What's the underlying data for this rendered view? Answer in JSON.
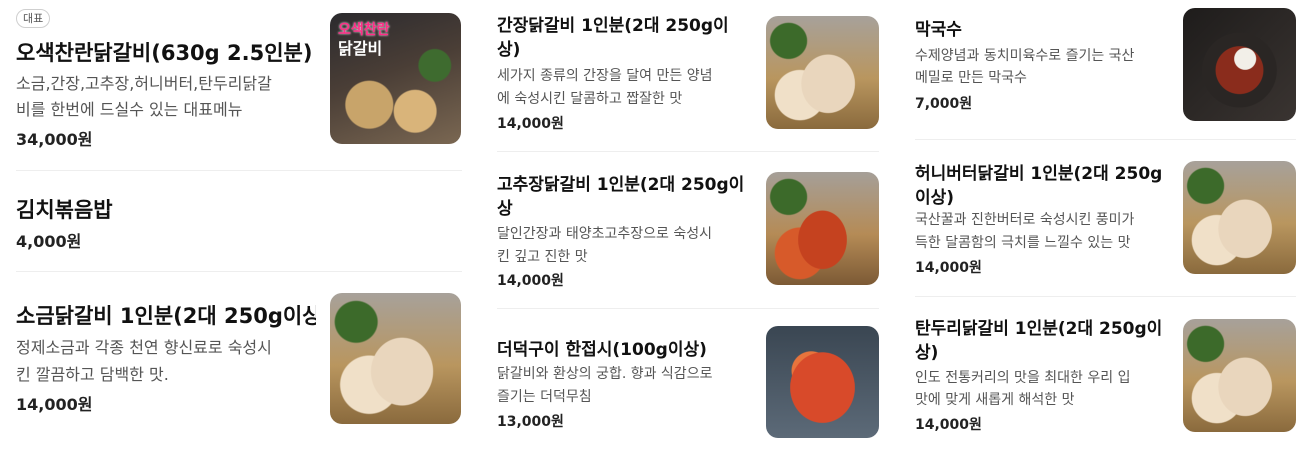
{
  "badge": "대표",
  "columns": [
    {
      "items": [
        {
          "name": "오색찬란닭갈비(630g 2.5인분)",
          "desc_lines": [
            "소금,간장,고추장,허니버터,탄두리닭갈",
            "비를 한번에 드실수 있는 대표메뉴"
          ],
          "price": "34,000원",
          "image": "grill",
          "image_text": [
            "오색찬란",
            "닭갈비"
          ]
        },
        {
          "name": "김치볶음밥",
          "desc_lines": [],
          "price": "4,000원",
          "image": null
        },
        {
          "name": "소금닭갈비 1인분(2대 250g이상",
          "desc_lines": [
            "정제소금과 각종 천연 향신료로 숙성시",
            "킨 깔끔하고 담백한 맛."
          ],
          "price": "14,000원",
          "image": "plain"
        }
      ]
    },
    {
      "items": [
        {
          "name_lines": [
            "간장닭갈비 1인분(2대 250g이",
            "상)"
          ],
          "desc_lines": [
            "세가지 종류의 간장을 달여 만든 양념",
            "에 숙성시킨 달콤하고 짭잘한 맛"
          ],
          "price": "14,000원",
          "image": "plain"
        },
        {
          "name_lines": [
            "고추장닭갈비 1인분(2대 250g이",
            "상"
          ],
          "desc_lines": [
            "달인간장과 태양초고추장으로 숙성시",
            "킨 깊고 진한 맛"
          ],
          "price": "14,000원",
          "image": "spicy"
        },
        {
          "name_lines": [
            "더덕구이 한접시(100g이상)"
          ],
          "desc_lines": [
            "닭갈비와 환상의 궁합. 향과 식감으로",
            "즐기는 더덕무침"
          ],
          "price": "13,000원",
          "image": "deodeok"
        }
      ]
    },
    {
      "items": [
        {
          "name_lines": [
            "막국수"
          ],
          "desc_lines": [
            "수제양념과 동치미육수로 즐기는 국산",
            "메밀로 만든 막국수"
          ],
          "price": "7,000원",
          "image": "makguksu"
        },
        {
          "name_lines": [
            "허니버터닭갈비 1인분(2대 250g",
            "이상)"
          ],
          "desc_lines": [
            "국산꿀과 진한버터로 숙성시킨 풍미가",
            "득한 달콤함의 극치를 느낄수 있는 맛"
          ],
          "price": "14,000원",
          "image": "plain"
        },
        {
          "name_lines": [
            "탄두리닭갈비 1인분(2대 250g이",
            "상)"
          ],
          "desc_lines": [
            "인도 전통커리의 맛을 최대한 우리 입",
            "맛에 맞게 새롭게 해석한 맛"
          ],
          "price": "14,000원",
          "image": "plain"
        }
      ]
    }
  ]
}
